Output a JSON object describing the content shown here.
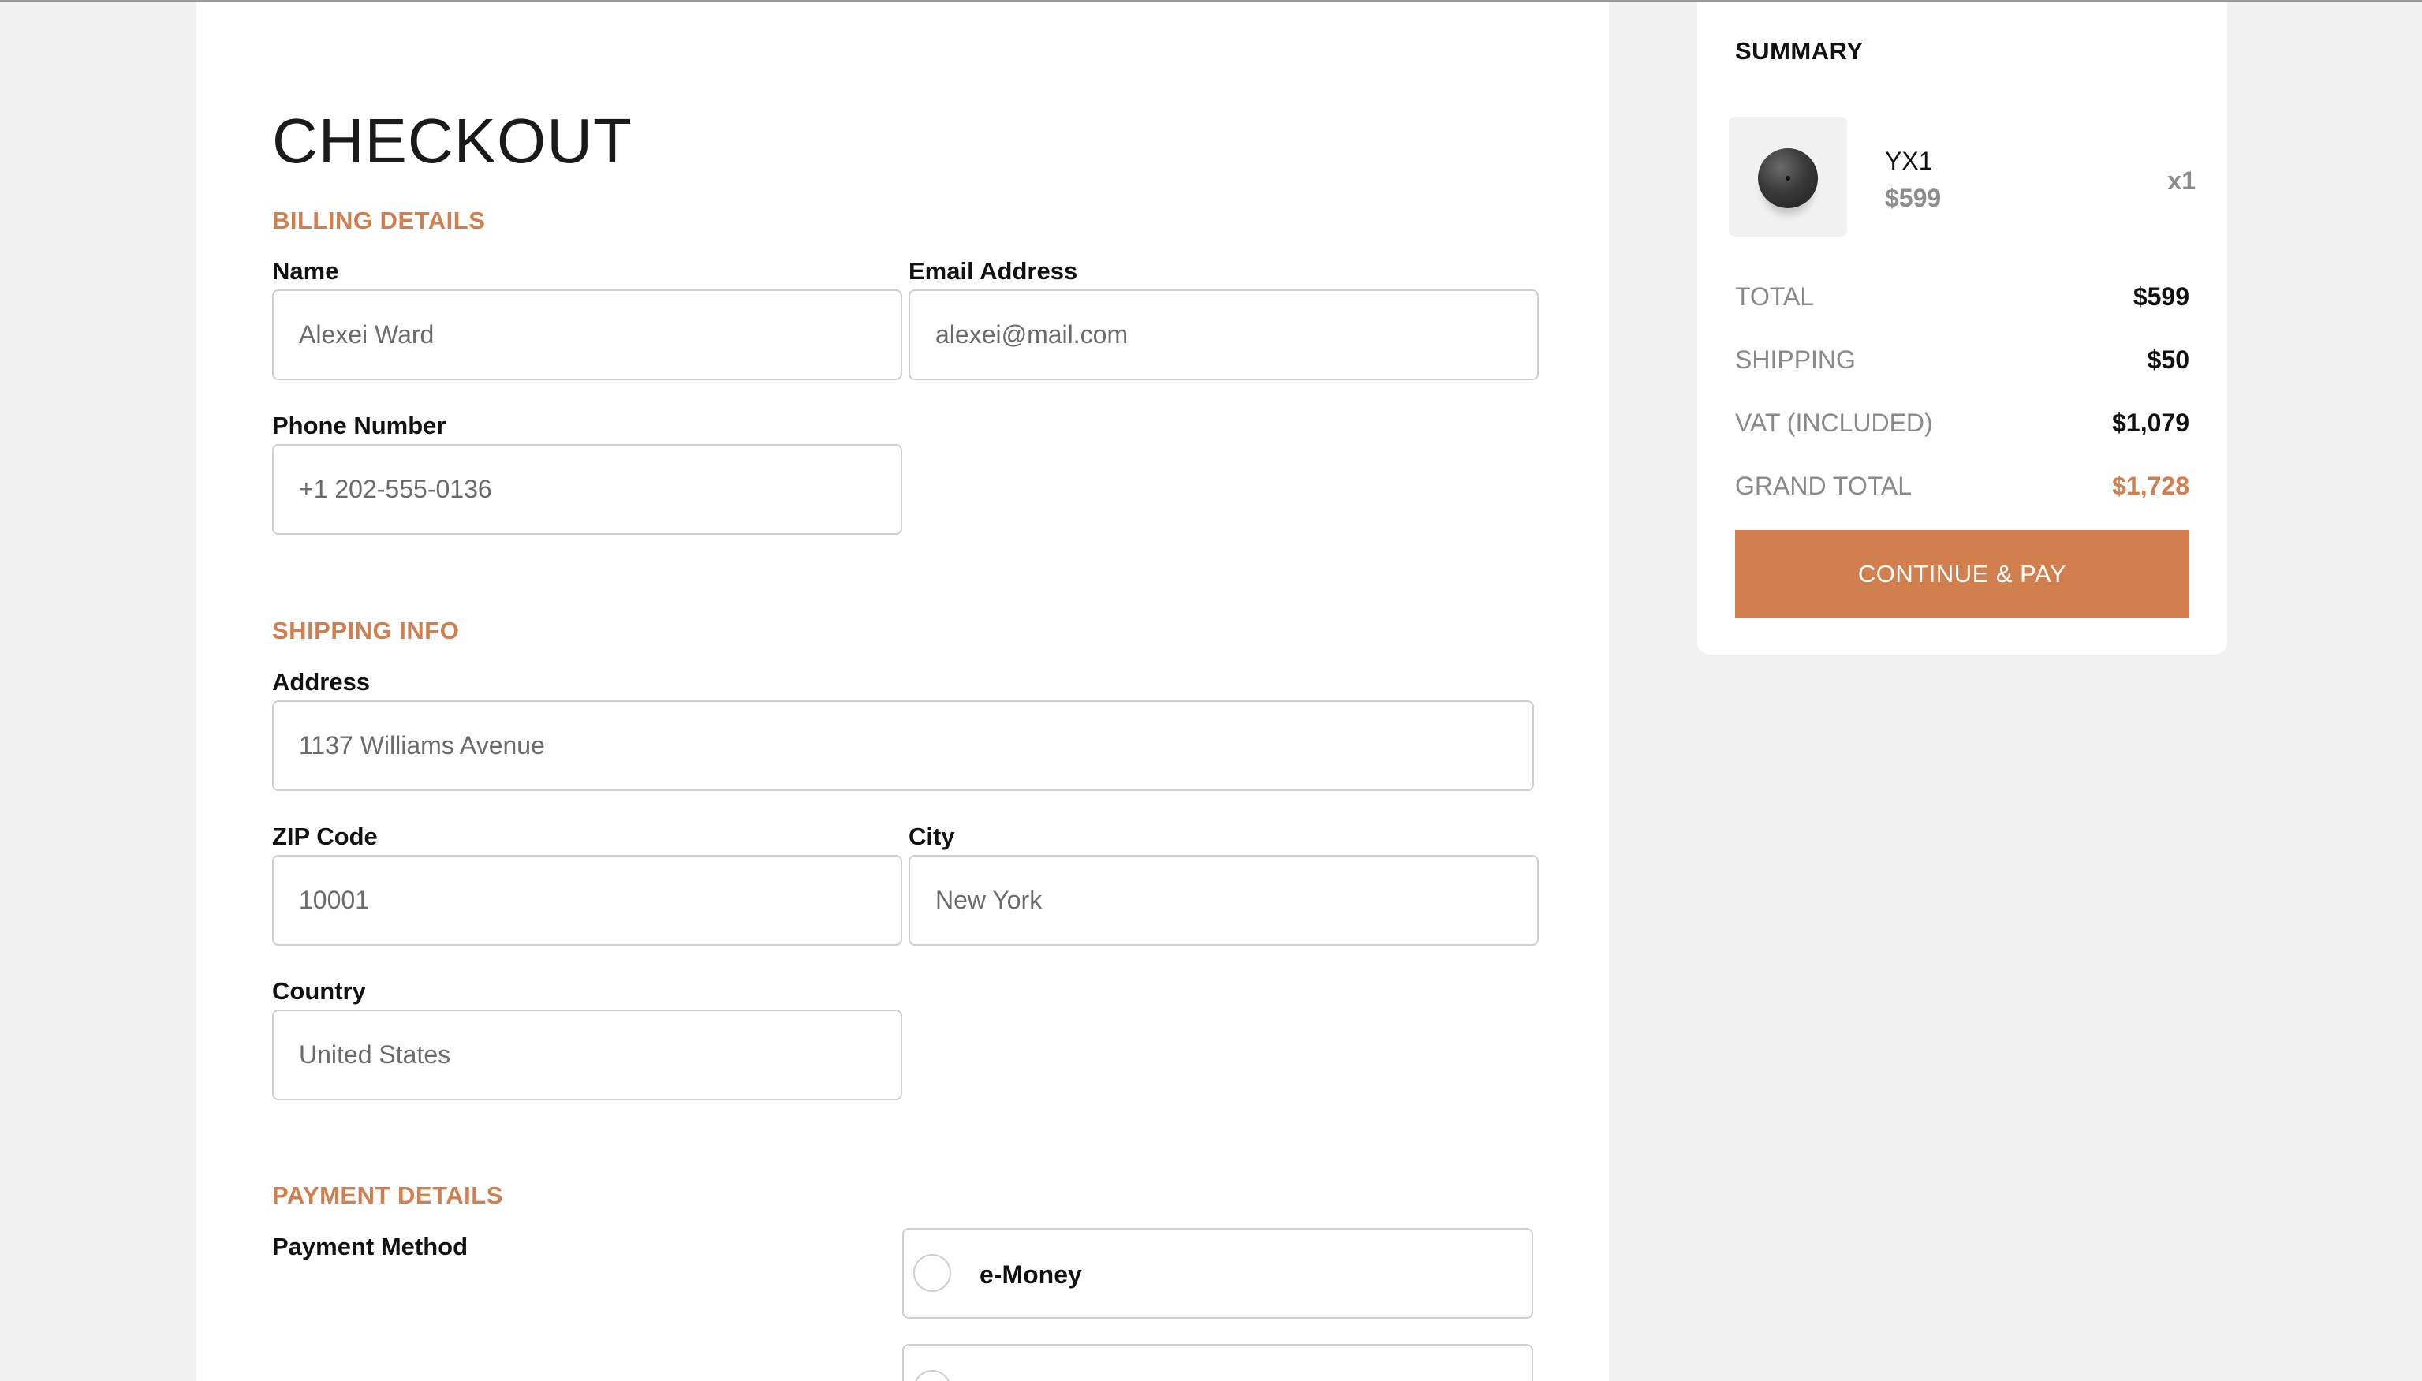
{
  "checkout": {
    "title": "CHECKOUT",
    "billing": {
      "heading": "BILLING DETAILS",
      "name": {
        "label": "Name",
        "value": "Alexei Ward"
      },
      "email": {
        "label": "Email Address",
        "value": "alexei@mail.com"
      },
      "phone": {
        "label": "Phone Number",
        "value": "+1 202-555-0136"
      }
    },
    "shipping": {
      "heading": "SHIPPING INFO",
      "address": {
        "label": "Address",
        "value": "1137 Williams Avenue"
      },
      "zip": {
        "label": "ZIP Code",
        "value": "10001"
      },
      "city": {
        "label": "City",
        "value": "New York"
      },
      "country": {
        "label": "Country",
        "value": "United States"
      }
    },
    "payment": {
      "heading": "PAYMENT DETAILS",
      "method_label": "Payment Method",
      "options": [
        {
          "label": "e-Money"
        },
        {
          "label": ""
        }
      ]
    }
  },
  "summary": {
    "title": "SUMMARY",
    "item": {
      "name": "YX1",
      "price": "$599",
      "quantity": "x1"
    },
    "rows": [
      {
        "label": "TOTAL",
        "value": "$599"
      },
      {
        "label": "SHIPPING",
        "value": "$50"
      },
      {
        "label": "VAT (INCLUDED)",
        "value": "$1,079"
      },
      {
        "label": "GRAND TOTAL",
        "value": "$1,728"
      }
    ],
    "pay_button": "CONTINUE & PAY"
  },
  "colors": {
    "accent": "#d27f4f",
    "background": "#f1f1f1",
    "card": "#ffffff"
  }
}
